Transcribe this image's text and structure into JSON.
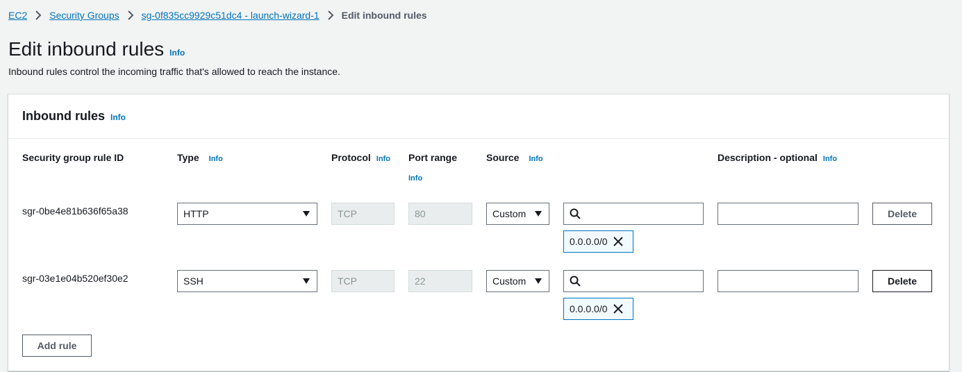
{
  "breadcrumb": {
    "items": [
      "EC2",
      "Security Groups",
      "sg-0f835cc9929c51dc4 - launch-wizard-1"
    ],
    "current": "Edit inbound rules"
  },
  "page": {
    "title": "Edit inbound rules",
    "info": "Info",
    "description": "Inbound rules control the incoming traffic that's allowed to reach the instance."
  },
  "panel": {
    "title": "Inbound rules",
    "info": "Info"
  },
  "columns": {
    "rule_id": "Security group rule ID",
    "type": "Type",
    "protocol": "Protocol",
    "port_range": "Port range",
    "source": "Source",
    "description": "Description - optional",
    "info": "Info"
  },
  "rules": [
    {
      "id": "sgr-0be4e81b636f65a38",
      "type": "HTTP",
      "protocol": "TCP",
      "port": "80",
      "source": "Custom",
      "search_value": "",
      "token": "0.0.0.0/0",
      "description": "",
      "delete_label": "Delete"
    },
    {
      "id": "sgr-03e1e04b520ef30e2",
      "type": "SSH",
      "protocol": "TCP",
      "port": "22",
      "source": "Custom",
      "search_value": "",
      "token": "0.0.0.0/0",
      "description": "",
      "delete_label": "Delete"
    }
  ],
  "actions": {
    "add_rule": "Add rule"
  },
  "colors": {
    "link": "#0073bb",
    "background": "#f2f3f3",
    "token_border": "#0073bb",
    "token_bg": "#f1faff"
  }
}
